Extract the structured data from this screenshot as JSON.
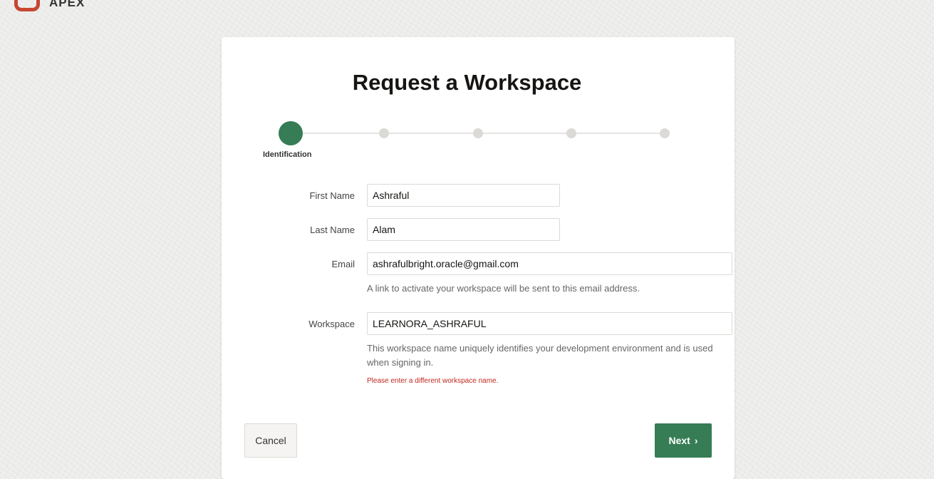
{
  "brand": {
    "name": "APEX",
    "color": "#c74634"
  },
  "title": "Request a Workspace",
  "steps": [
    {
      "label": "Identification",
      "active": true
    },
    {
      "label": "",
      "active": false
    },
    {
      "label": "",
      "active": false
    },
    {
      "label": "",
      "active": false
    },
    {
      "label": "",
      "active": false
    }
  ],
  "form": {
    "first_name": {
      "label": "First Name",
      "value": "Ashraful"
    },
    "last_name": {
      "label": "Last Name",
      "value": "Alam"
    },
    "email": {
      "label": "Email",
      "value": "ashrafulbright.oracle@gmail.com",
      "help": "A link to activate your workspace will be sent to this email address."
    },
    "workspace": {
      "label": "Workspace",
      "value": "LEARNORA_ASHRAFUL",
      "help": "This workspace name uniquely identifies your development environment and is used when signing in.",
      "error": "Please enter a different workspace name."
    }
  },
  "buttons": {
    "cancel": "Cancel",
    "next": "Next",
    "next_icon": "chevron-right-icon"
  },
  "colors": {
    "accent": "#367c55",
    "error": "#c2271f"
  }
}
